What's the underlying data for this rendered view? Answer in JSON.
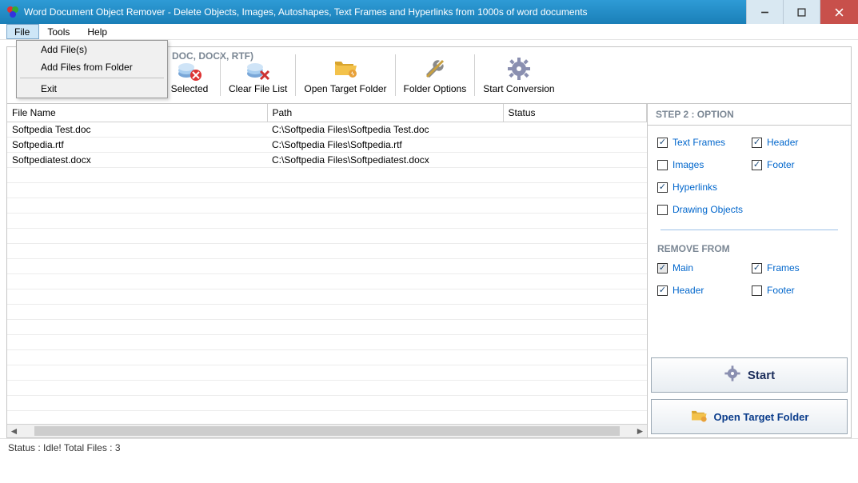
{
  "window": {
    "title": "Word Document Object Remover - Delete Objects, Images, Autoshapes, Text Frames and Hyperlinks from 1000s of word documents"
  },
  "menubar": {
    "items": [
      "File",
      "Tools",
      "Help"
    ]
  },
  "file_menu": {
    "add_files": "Add File(s)",
    "add_folder": "Add Files from Folder",
    "exit": "Exit"
  },
  "step1": {
    "label_fragment": "DOC, DOCX, RTF)"
  },
  "toolbar": {
    "remove_selected": "Selected",
    "clear_list": "Clear File List",
    "open_target": "Open Target Folder",
    "folder_options": "Folder Options",
    "start_conv": "Start Conversion"
  },
  "table": {
    "headers": {
      "file": "File Name",
      "path": "Path",
      "status": "Status"
    },
    "rows": [
      {
        "file": "Softpedia Test.doc",
        "path": "C:\\Softpedia Files\\Softpedia Test.doc",
        "status": ""
      },
      {
        "file": "Softpedia.rtf",
        "path": "C:\\Softpedia Files\\Softpedia.rtf",
        "status": ""
      },
      {
        "file": "Softpediatest.docx",
        "path": "C:\\Softpedia Files\\Softpediatest.docx",
        "status": ""
      }
    ]
  },
  "options": {
    "header": "STEP 2 : OPTION",
    "text_frames": "Text Frames",
    "header_chk": "Header",
    "images": "Images",
    "footer_chk": "Footer",
    "hyperlinks": "Hyperlinks",
    "drawing": "Drawing Objects",
    "remove_from": "REMOVE FROM",
    "main": "Main",
    "frames": "Frames",
    "rf_header": "Header",
    "rf_footer": "Footer"
  },
  "buttons": {
    "start": "Start",
    "open_target": "Open Target Folder"
  },
  "status": {
    "text": "Status  :  Idle!  Total Files : 3"
  }
}
